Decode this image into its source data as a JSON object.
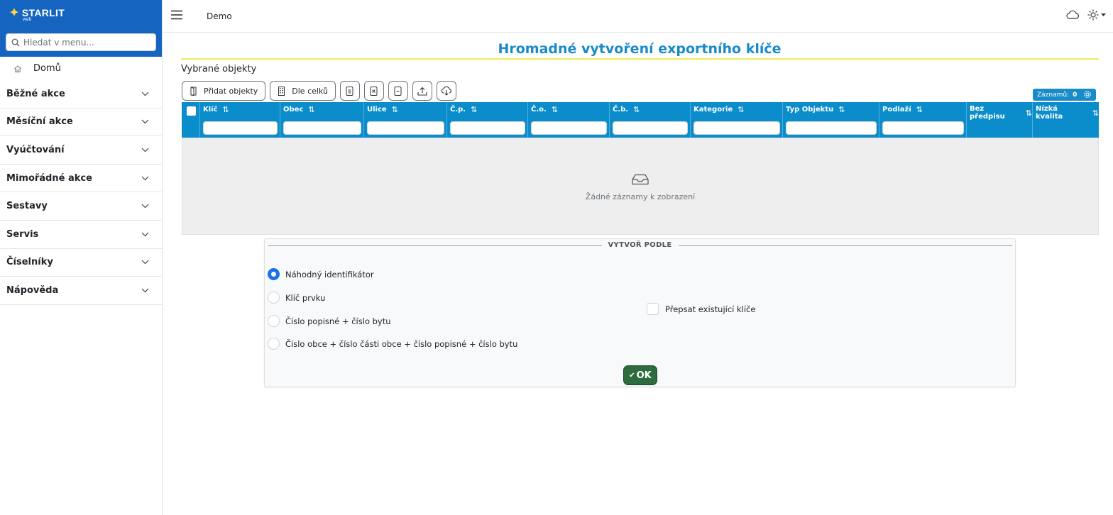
{
  "sidebar": {
    "logo_text": "STARLIT",
    "logo_sub": "web",
    "search_placeholder": "Hledat v menu...",
    "home_label": "Domů",
    "items": [
      {
        "label": "Běžné akce"
      },
      {
        "label": "Měsíční akce"
      },
      {
        "label": "Vyúčtování"
      },
      {
        "label": "Mimořádné akce"
      },
      {
        "label": "Sestavy"
      },
      {
        "label": "Servis"
      },
      {
        "label": "Číselníky"
      },
      {
        "label": "Nápověda"
      }
    ]
  },
  "topbar": {
    "breadcrumb": "Demo"
  },
  "page": {
    "title": "Hromadné vytvoření exportního klíče",
    "section_label": "Vybrané objekty"
  },
  "toolbar": {
    "add_objects": "Přidat objekty",
    "by_units": "Dle celků"
  },
  "records": {
    "label": "Záznamů:",
    "count": "0"
  },
  "grid": {
    "columns": [
      "Klíč",
      "Obec",
      "Ulice",
      "Č.p.",
      "Č.o.",
      "Č.b.",
      "Kategorie",
      "Typ Objektu",
      "Podlaží",
      "Bez předpisu",
      "Nízká kvalita"
    ],
    "empty_text": "Žádné záznamy k zobrazení"
  },
  "create_by": {
    "legend": "VYTVOŘ PODLE",
    "options": [
      {
        "label": "Náhodný identifikátor",
        "selected": true
      },
      {
        "label": "Klíč prvku",
        "selected": false
      },
      {
        "label": "Číslo popisné + číslo bytu",
        "selected": false
      },
      {
        "label": "Číslo obce + číslo části obce + číslo popisné + číslo bytu",
        "selected": false
      }
    ],
    "overwrite_label": "Přepsat existující klíče",
    "overwrite_checked": false,
    "ok_label": "OK"
  },
  "colors": {
    "brand": "#1565c0",
    "accent": "#1a8bc9",
    "grid_header": "#0b8dcc",
    "ok": "#2e6b3e"
  }
}
